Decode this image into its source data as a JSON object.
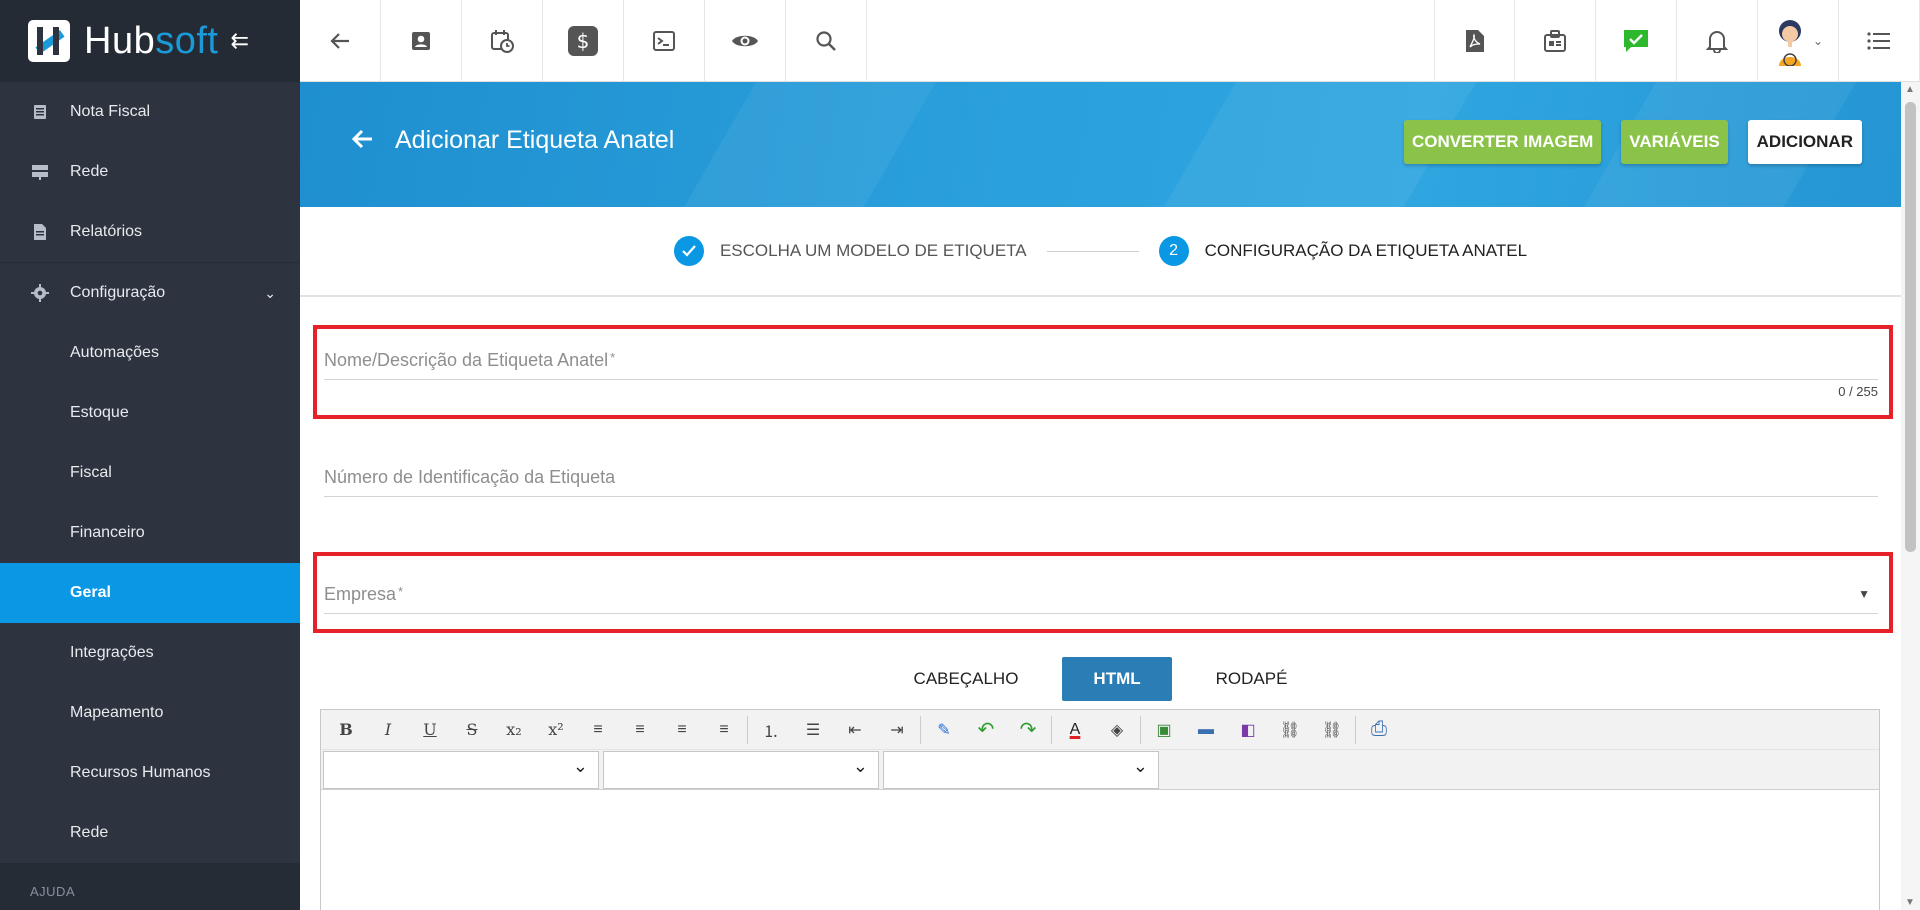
{
  "brand": {
    "name_part1": "Hub",
    "name_part2": "soft",
    "collapse_icon": "collapse-left-icon"
  },
  "sidebar": {
    "items": [
      {
        "label": "Nota Fiscal",
        "icon": "document-icon"
      },
      {
        "label": "Rede",
        "icon": "server-icon"
      },
      {
        "label": "Relatórios",
        "icon": "report-icon"
      },
      {
        "label": "Configuração",
        "icon": "gear-icon"
      }
    ],
    "subitems": [
      {
        "label": "Automações"
      },
      {
        "label": "Estoque"
      },
      {
        "label": "Fiscal"
      },
      {
        "label": "Financeiro"
      },
      {
        "label": "Geral"
      },
      {
        "label": "Integrações"
      },
      {
        "label": "Mapeamento"
      },
      {
        "label": "Recursos Humanos"
      },
      {
        "label": "Rede"
      }
    ],
    "active_subitem": "Geral",
    "section_label": "AJUDA"
  },
  "topbar": {
    "left_icons": [
      "back-arrow-icon",
      "contact-card-icon",
      "calendar-clock-icon",
      "dollar-icon",
      "terminal-icon",
      "eye-icon",
      "search-icon"
    ],
    "right_icons": [
      "pdf-icon",
      "badge-icon",
      "chat-check-icon",
      "bell-icon",
      "avatar",
      "list-icon"
    ],
    "accent_green": "#2eb82e"
  },
  "page": {
    "title": "Adicionar Etiqueta Anatel",
    "actions": {
      "convert_image": "CONVERTER IMAGEM",
      "variables": "VARIÁVEIS",
      "add": "ADICIONAR"
    },
    "colors": {
      "banner": "#2aa0dc",
      "green_button": "#8bc34a",
      "step_blue": "#0a98e4",
      "highlight_red": "#e5222a"
    }
  },
  "stepper": {
    "step1": {
      "label": "ESCOLHA UM MODELO DE ETIQUETA",
      "state": "done"
    },
    "step2": {
      "number": "2",
      "label": "CONFIGURAÇÃO DA ETIQUETA ANATEL",
      "state": "current"
    }
  },
  "form": {
    "name": {
      "placeholder": "Nome/Descrição da Etiqueta Anatel",
      "required_mark": "*",
      "counter": "0 / 255"
    },
    "id_number": {
      "placeholder": "Número de Identificação da Etiqueta"
    },
    "company": {
      "placeholder": "Empresa",
      "required_mark": "*"
    }
  },
  "tabs": [
    {
      "label": "CABEÇALHO"
    },
    {
      "label": "HTML"
    },
    {
      "label": "RODAPÉ"
    }
  ],
  "active_tab": "HTML",
  "editor": {
    "tools": {
      "bold": "B",
      "italic": "I",
      "underline": "U",
      "strike": "S",
      "subscript": "x₂",
      "superscript": "x²",
      "align_left": "≡",
      "align_center": "≡",
      "align_right": "≡",
      "justify": "≡",
      "ordered_list": "⒈",
      "unordered_list": "☰",
      "outdent": "⇤",
      "indent": "⇥",
      "clean": "✎",
      "undo": "↶",
      "redo": "↷",
      "text_color": "A",
      "highlight": "◈",
      "image": "▣",
      "hr": "▬",
      "table": "◧",
      "link": "⛓",
      "unlink": "⛓",
      "print": "⎙"
    }
  }
}
